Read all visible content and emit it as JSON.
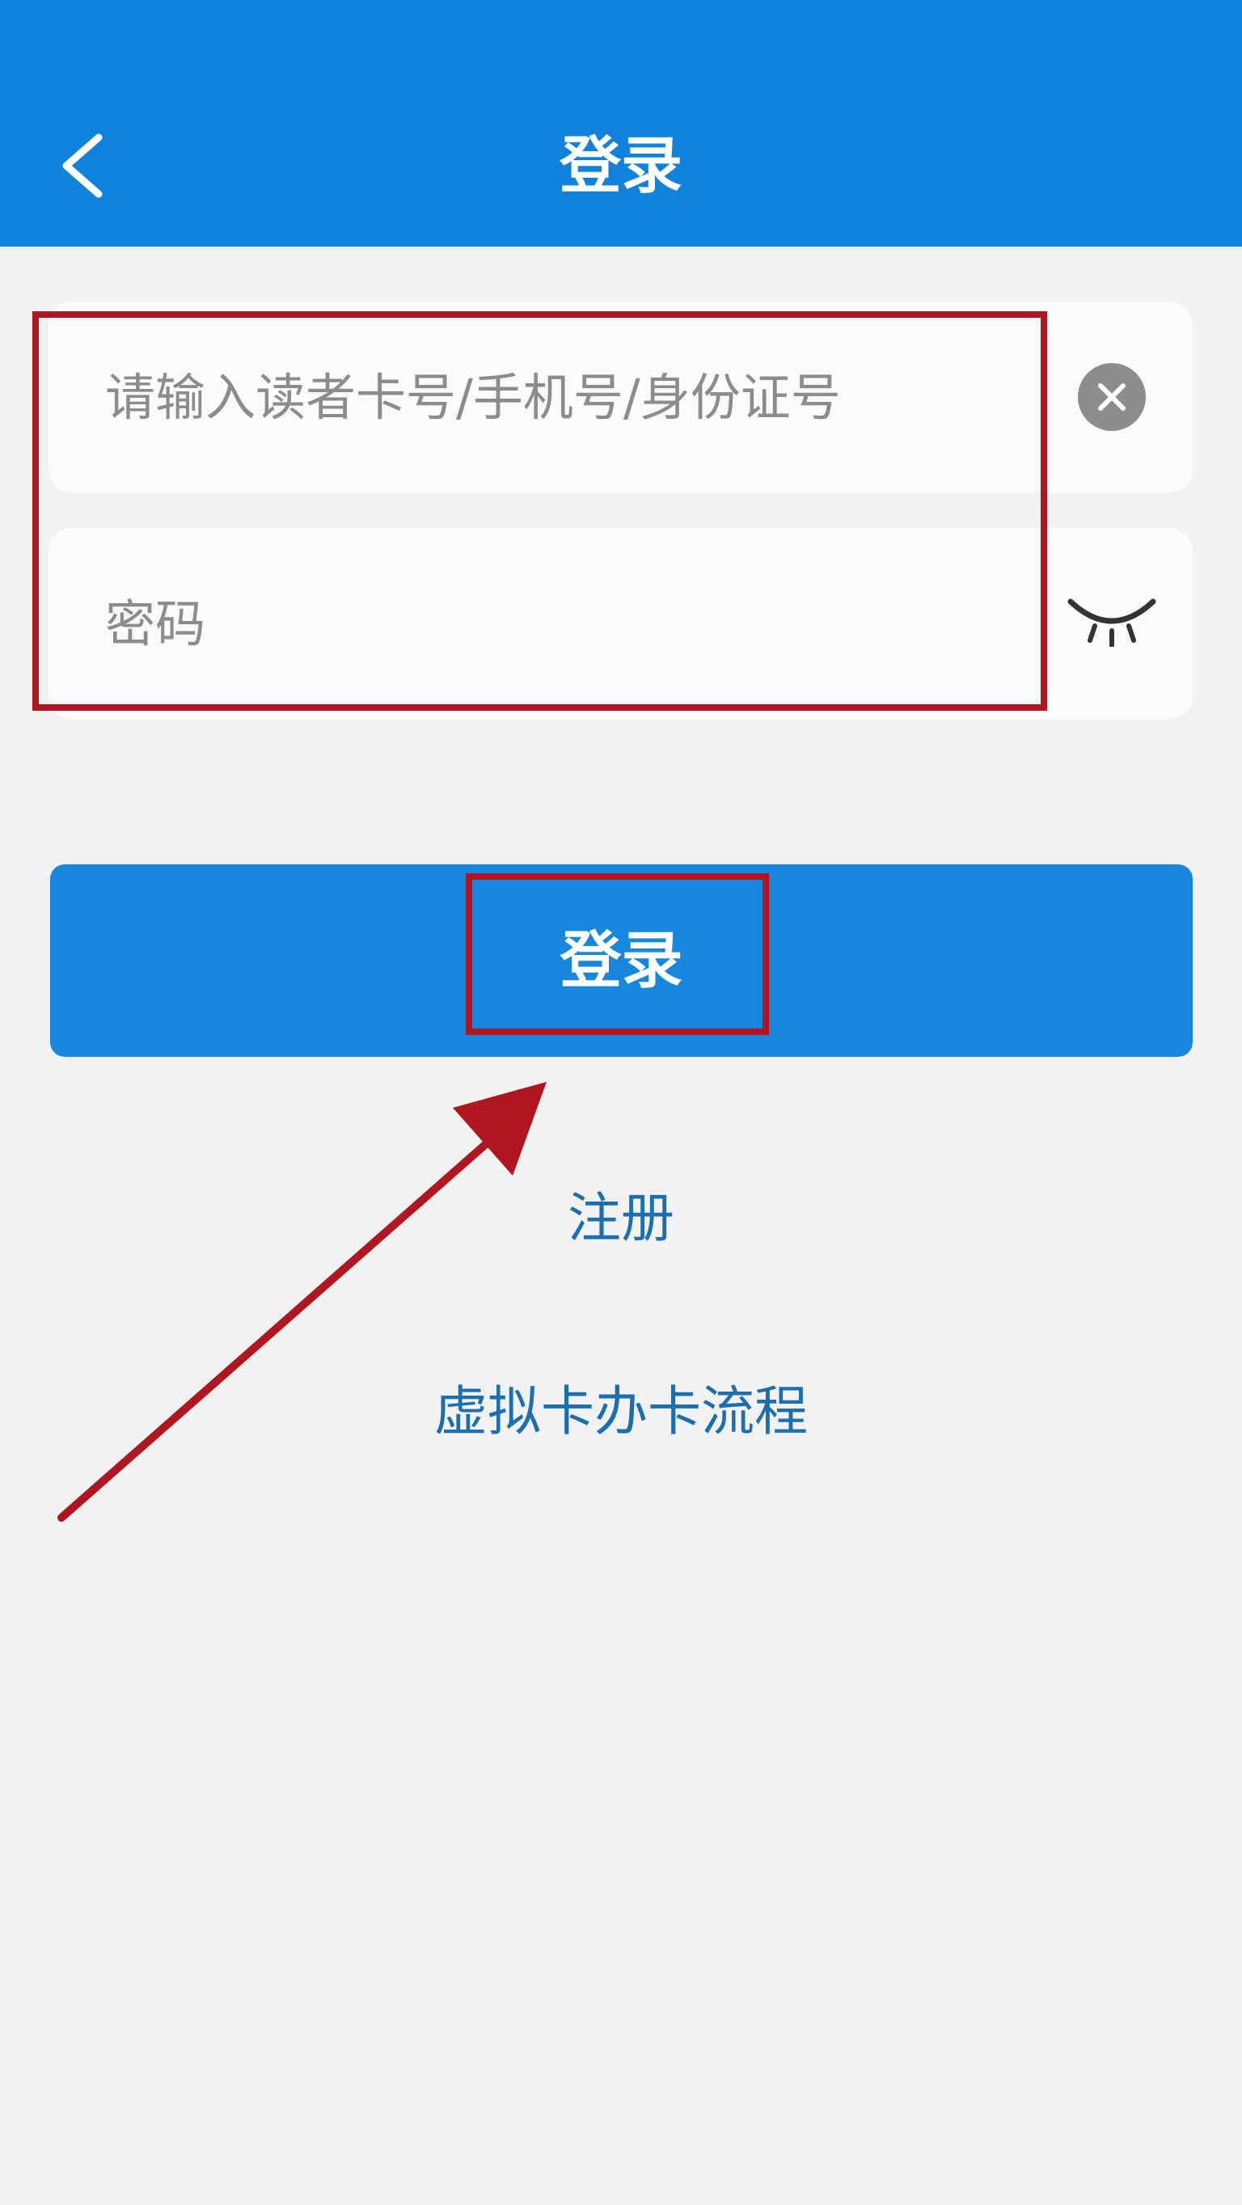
{
  "header": {
    "title": "登录",
    "back_icon": "chevron-left-icon"
  },
  "form": {
    "account_placeholder": "请输入读者卡号/手机号/身份证号",
    "password_placeholder": "密码",
    "clear_icon": "clear-circle-icon",
    "visibility_icon": "eye-closed-icon"
  },
  "actions": {
    "login_label": "登录",
    "register_label": "注册",
    "virtual_card_label": "虚拟卡办卡流程"
  },
  "colors": {
    "header_bg": "#1182dc",
    "button_bg": "#1786dd",
    "link_text": "#1c6fae",
    "annotation_red": "#b01620",
    "page_bg": "#f2f2f2"
  }
}
